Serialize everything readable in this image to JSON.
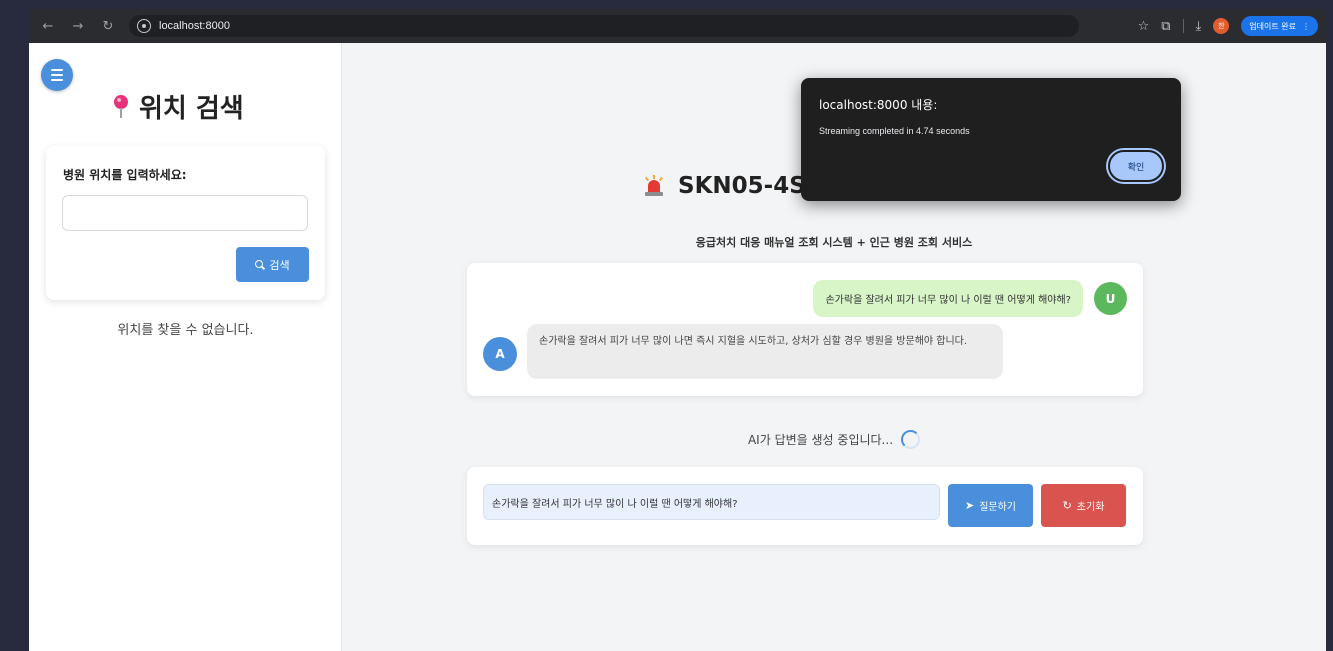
{
  "browser": {
    "url": "localhost:8000",
    "update_label": "업데이트 완료",
    "profile_initial": "한"
  },
  "sidebar": {
    "title": "위치 검색",
    "search_label": "병원 위치를 입력하세요:",
    "search_value": "",
    "search_button": "검색",
    "not_found": "위치를 찾을 수 없습니다."
  },
  "alert": {
    "title": "localhost:8000 내용:",
    "message": "Streaming completed in 4.74 seconds",
    "ok_label": "확인"
  },
  "main": {
    "title": "SKN05-4ST-2Team",
    "subtitle": "응급처치 대응 매뉴얼 조회 시스템 + 인근 병원 조회 서비스",
    "messages": [
      {
        "role": "user",
        "avatar": "U",
        "text": "손가락을 잘려서 피가 너무 많이 나 이럴 땐 어떻게 해야해?"
      },
      {
        "role": "assistant",
        "avatar": "A",
        "text": "손가락을 잘려서 피가 너무 많이 나면 즉시 지혈을 시도하고, 상처가 심할 경우 병원을 방문해야 합니다."
      }
    ],
    "status": "AI가 답변을 생성 중입니다...",
    "question_value": "손가락을 잘려서 피가 너무 많이 나 이럴 땐 어떻게 해야해?",
    "ask_button": "질문하기",
    "reset_button": "초기화"
  },
  "colors": {
    "primary": "#4a8fdb",
    "danger": "#d9534f",
    "user_bubble": "#d8f5c8",
    "user_avatar": "#5cb85c"
  },
  "icons": [
    "menu-icon",
    "pin-icon",
    "search-icon",
    "siren-icon",
    "send-icon",
    "refresh-icon",
    "spinner-icon"
  ]
}
